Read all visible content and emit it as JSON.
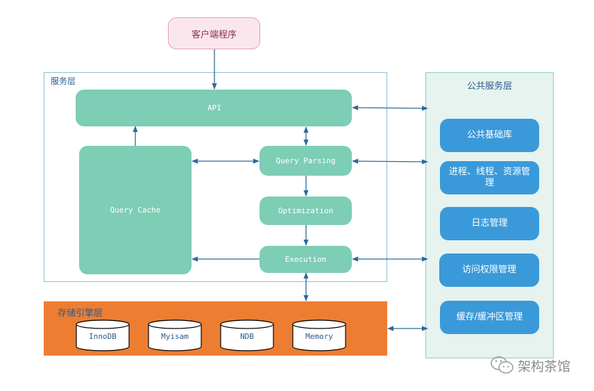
{
  "client": {
    "label": "客户端程序"
  },
  "service_layer": {
    "title": "服务层",
    "api": "API",
    "query_cache": "Query Cache",
    "query_parsing": "Query Parsing",
    "optimization": "Optimization",
    "execution": "Execution"
  },
  "public_layer": {
    "title": "公共服务层",
    "items": [
      {
        "label": "公共基础库"
      },
      {
        "label": "进程、线程、资源管理"
      },
      {
        "label": "日志管理"
      },
      {
        "label": "访问权限管理"
      },
      {
        "label": "缓存/缓冲区管理"
      }
    ]
  },
  "storage_layer": {
    "title": "存储引擎层",
    "engines": [
      {
        "label": "InnoDB"
      },
      {
        "label": "Myisam"
      },
      {
        "label": "NDB"
      },
      {
        "label": "Memory"
      }
    ]
  },
  "watermark": {
    "text": "架构茶馆",
    "icon": "wechat-icon"
  },
  "colors": {
    "service_box": "#7ecdb5",
    "public_box": "#3a9ad9",
    "storage_layer": "#ed7d31",
    "client_box": "#fbe6ee",
    "arrow": "#2a6a9c"
  }
}
